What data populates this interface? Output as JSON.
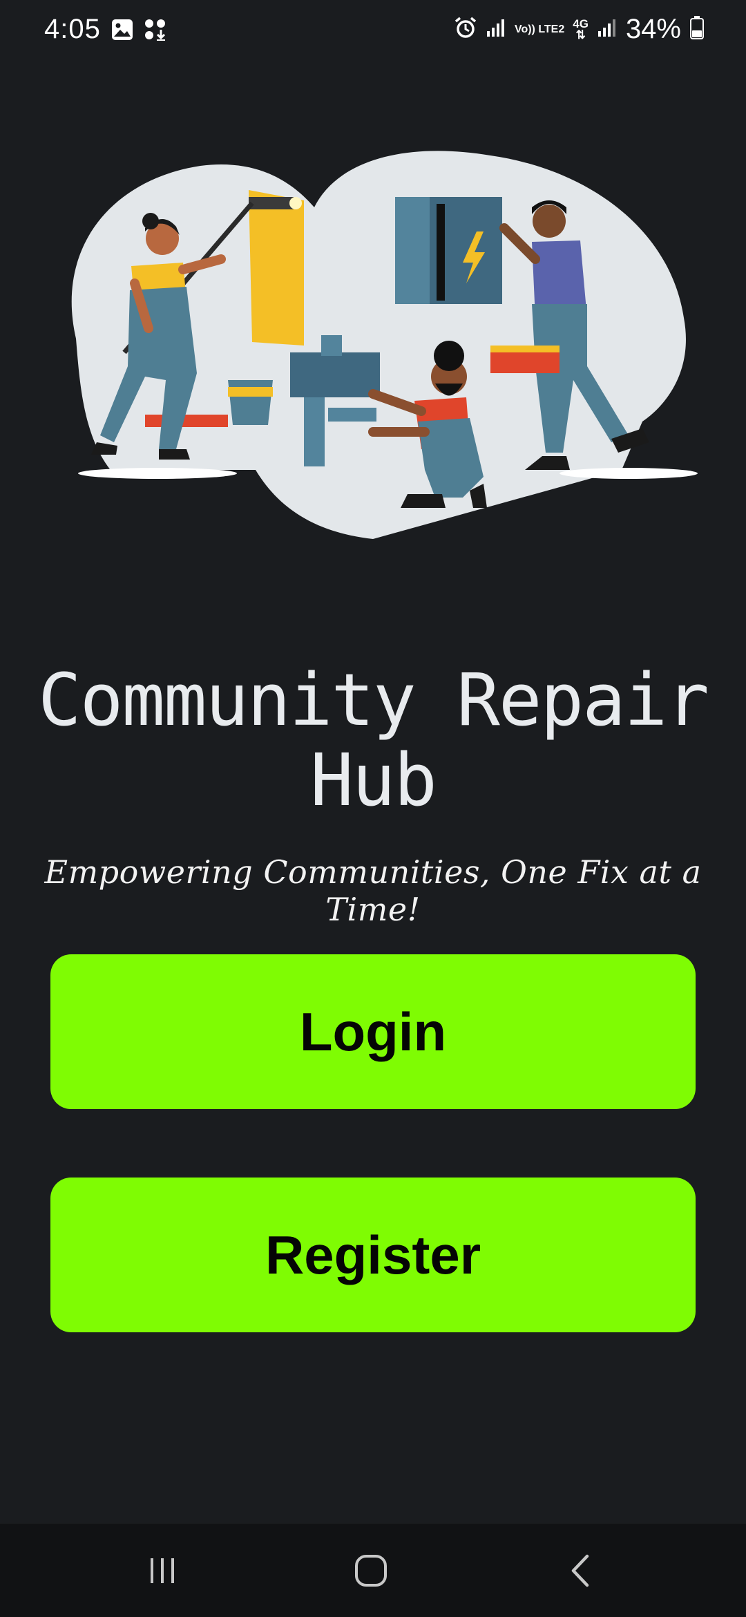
{
  "status_bar": {
    "time": "4:05",
    "battery": "34%",
    "icons": [
      "gallery-icon",
      "app-grid-download-icon",
      "alarm-icon",
      "signal-icon",
      "volte-lte2-icon",
      "4g-data-icon",
      "signal-icon-2",
      "battery-icon"
    ],
    "volte_label": "Vo)) LTE2",
    "network_label": "4G"
  },
  "app": {
    "title": "Community Repair Hub",
    "tagline": "Empowering Communities, One Fix at a Time!",
    "accent_color": "#7ffc03",
    "background_color": "#1a1c1f"
  },
  "buttons": {
    "login_label": "Login",
    "register_label": "Register"
  },
  "nav_bar": {
    "icons": [
      "recents-icon",
      "home-icon",
      "back-icon"
    ]
  }
}
